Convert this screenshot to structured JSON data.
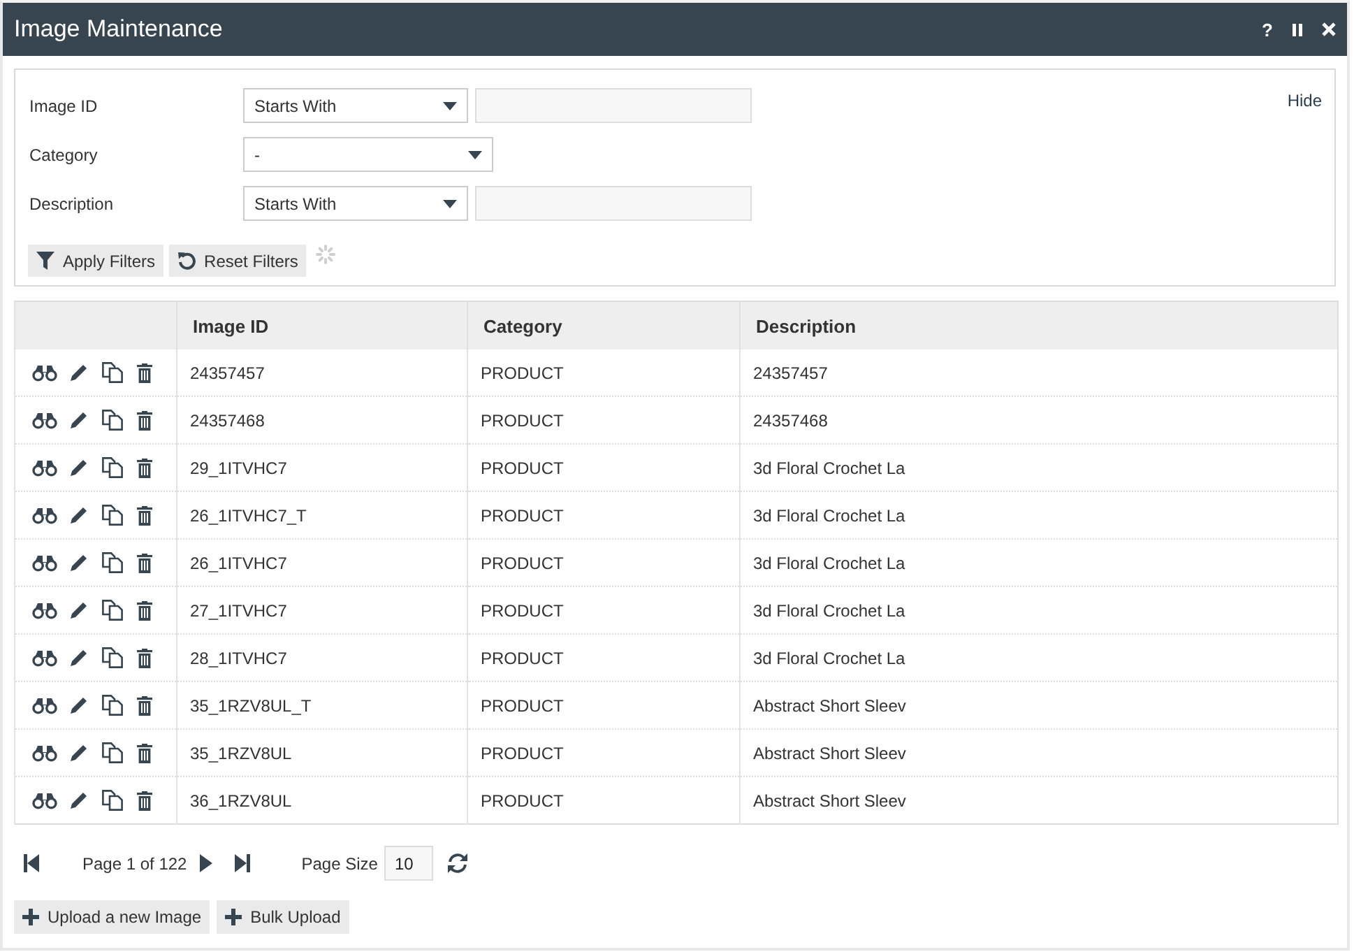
{
  "window": {
    "title": "Image Maintenance",
    "controls": [
      {
        "kind": "help",
        "label": "?"
      },
      {
        "kind": "pause"
      },
      {
        "kind": "close"
      }
    ]
  },
  "filters": {
    "hide_link": "Hide",
    "rows": [
      {
        "kind": "match",
        "label": "Image ID",
        "operator": "Starts With"
      },
      {
        "kind": "choice",
        "label": "Category",
        "operator": "-"
      },
      {
        "kind": "match",
        "label": "Description",
        "operator": "Starts With"
      }
    ],
    "buttons": [
      {
        "kind": "filter",
        "label": "Apply Filters"
      },
      {
        "kind": "reset",
        "label": "Reset Filters"
      }
    ],
    "loading": true
  },
  "table": {
    "columns": [
      "Image ID",
      "Category",
      "Description"
    ],
    "rows": [
      {
        "image_id": "24357457",
        "category": "PRODUCT",
        "description": "24357457"
      },
      {
        "image_id": "24357468",
        "category": "PRODUCT",
        "description": "24357468"
      },
      {
        "image_id": "29_1ITVHC7",
        "category": "PRODUCT",
        "description": "3d Floral Crochet La"
      },
      {
        "image_id": "26_1ITVHC7_T",
        "category": "PRODUCT",
        "description": "3d Floral Crochet La"
      },
      {
        "image_id": "26_1ITVHC7",
        "category": "PRODUCT",
        "description": "3d Floral Crochet La"
      },
      {
        "image_id": "27_1ITVHC7",
        "category": "PRODUCT",
        "description": "3d Floral Crochet La"
      },
      {
        "image_id": "28_1ITVHC7",
        "category": "PRODUCT",
        "description": "3d Floral Crochet La"
      },
      {
        "image_id": "35_1RZV8UL_T",
        "category": "PRODUCT",
        "description": "Abstract Short Sleev"
      },
      {
        "image_id": "35_1RZV8UL",
        "category": "PRODUCT",
        "description": "Abstract Short Sleev"
      },
      {
        "image_id": "36_1RZV8UL",
        "category": "PRODUCT",
        "description": "Abstract Short Sleev"
      }
    ]
  },
  "pagination": {
    "page_label": "Page 1 of 122",
    "page_size_label": "Page Size",
    "page_size": "10"
  },
  "footer_buttons": [
    {
      "kind": "add",
      "label": "Upload a new Image"
    },
    {
      "kind": "add",
      "label": "Bulk Upload"
    }
  ]
}
